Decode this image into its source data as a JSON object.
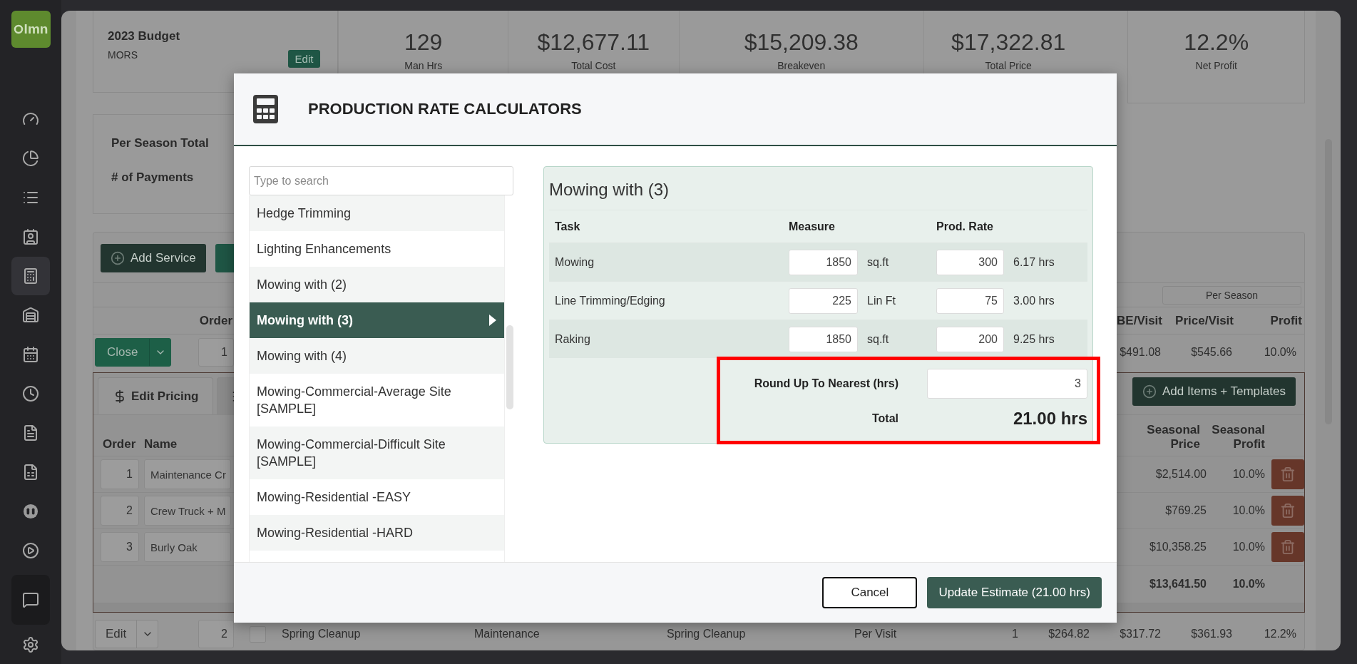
{
  "sidebar": {
    "logo": "lmn",
    "items": [
      {
        "selected": false
      },
      {
        "selected": false
      },
      {
        "selected": false
      },
      {
        "selected": false
      },
      {
        "selected": true
      },
      {
        "selected": false
      },
      {
        "selected": false
      },
      {
        "selected": false
      },
      {
        "selected": false
      },
      {
        "selected": false
      },
      {
        "selected": false
      },
      {
        "selected": false
      },
      {
        "selected": false
      },
      {
        "selected": false
      }
    ]
  },
  "budget": {
    "title": "2023 Budget",
    "subtitle": "MORS",
    "edit_button": "Edit"
  },
  "stats": [
    {
      "value": "129",
      "label": "Man Hrs"
    },
    {
      "value": "$12,677.11",
      "label": "Total Cost"
    },
    {
      "value": "$15,209.38",
      "label": "Breakeven"
    },
    {
      "value": "$17,322.81",
      "label": "Total Price"
    },
    {
      "value": "12.2%",
      "label": "Net Profit"
    }
  ],
  "season_summary": {
    "labels": [
      "Per Season Total",
      "# of Payments"
    ]
  },
  "services": {
    "add_button": "Add Service",
    "group_header": "Per Season",
    "columns": {
      "order": "Order",
      "be_visit": "BE/Visit",
      "price_visit": "Price/Visit",
      "profit": "Profit"
    },
    "rows": [
      {
        "action": "Close",
        "order": "1",
        "expanded": true,
        "be_visit": "$491.08",
        "price_visit": "$545.66",
        "profit": "10.0%"
      },
      {
        "action": "Edit",
        "order": "2",
        "expanded": false,
        "checked": false,
        "name": "Spring Cleanup",
        "type": "Maintenance",
        "service": "Spring Cleanup",
        "frequency": "Per Visit",
        "visits": "1",
        "cost_visit": "$264.82",
        "be_visit": "$317.72",
        "price_visit": "$361.93",
        "profit": "12.2%"
      }
    ],
    "detail": {
      "tabs": [
        {
          "label": "Edit Pricing",
          "selected": true
        },
        {
          "selected": false
        }
      ],
      "add_items_button": "Add Items + Templates",
      "columns": {
        "order": "Order",
        "name": "Name",
        "seasonal_price": "Seasonal Price",
        "seasonal_profit": "Seasonal Profit"
      },
      "items": [
        {
          "order": "1",
          "name": "Maintenance Cr",
          "seasonal_price": "$2,514.00",
          "seasonal_profit": "10.0%"
        },
        {
          "order": "2",
          "name": "Crew Truck + M",
          "seasonal_price": "$769.25",
          "seasonal_profit": "10.0%"
        },
        {
          "order": "3",
          "name": "Burly Oak",
          "seasonal_price": "$10,358.25",
          "seasonal_profit": "10.0%"
        }
      ],
      "totals": {
        "seasonal_price": "$13,641.50",
        "seasonal_profit": "10.0%"
      }
    }
  },
  "modal": {
    "title": "PRODUCTION RATE CALCULATORS",
    "search": {
      "placeholder": "Type to search"
    },
    "calculators": [
      {
        "name": "Hedge Trimming",
        "selected": false
      },
      {
        "name": "Lighting Enhancements",
        "selected": false
      },
      {
        "name": "Mowing with (2)",
        "selected": false
      },
      {
        "name": "Mowing with (3)",
        "selected": true
      },
      {
        "name": "Mowing with (4)",
        "selected": false
      },
      {
        "name": "Mowing-Commercial-Average Site [SAMPLE]",
        "selected": false
      },
      {
        "name": "Mowing-Commercial-Difficult Site [SAMPLE]",
        "selected": false
      },
      {
        "name": "Mowing-Residential -EASY",
        "selected": false
      },
      {
        "name": "Mowing-Residential -HARD",
        "selected": false
      }
    ],
    "detail": {
      "title": "Mowing with (3)",
      "columns": [
        "Task",
        "Measure",
        "Prod. Rate"
      ],
      "tasks": [
        {
          "task": "Mowing",
          "measure": "1850",
          "unit": "sq.ft",
          "rate": "300",
          "hours": "6.17 hrs"
        },
        {
          "task": "Line Trimming/Edging",
          "measure": "225",
          "unit": "Lin Ft",
          "rate": "75",
          "hours": "3.00 hrs"
        },
        {
          "task": "Raking",
          "measure": "1850",
          "unit": "sq.ft",
          "rate": "200",
          "hours": "9.25 hrs"
        }
      ],
      "round_up": {
        "label": "Round Up To Nearest (hrs)",
        "value": "3"
      },
      "total": {
        "label": "Total",
        "value": "21.00 hrs"
      }
    },
    "buttons": {
      "cancel": "Cancel",
      "update": "Update Estimate (21.00 hrs)"
    }
  }
}
